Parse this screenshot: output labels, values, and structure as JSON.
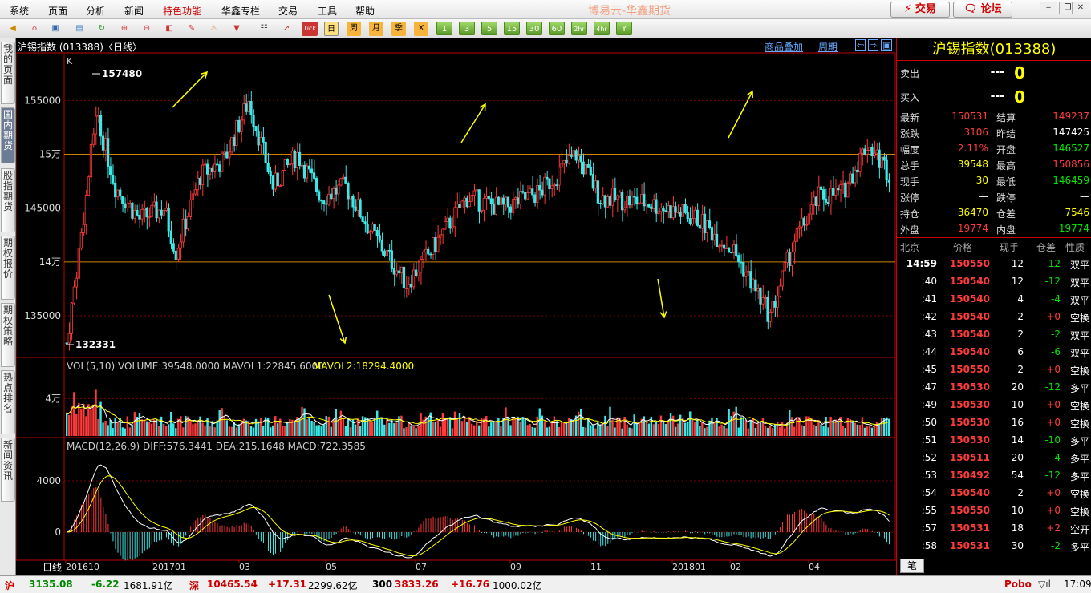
{
  "menu": [
    "系统",
    "页面",
    "分析",
    "新闻",
    "特色功能",
    "华鑫专栏",
    "交易",
    "工具",
    "帮助"
  ],
  "brand": "博易云-华鑫期货",
  "buttons": {
    "trade": "⚡ 交易",
    "forum": "🗨 论坛"
  },
  "toolbar": {
    "tick": "Tick",
    "day": "日",
    "week": "周",
    "month": "月",
    "season": "季",
    "x": "X",
    "nums": [
      "1",
      "3",
      "5",
      "15",
      "30",
      "60",
      "2hr",
      "4hr",
      "Y"
    ]
  },
  "sidebar": [
    "我的页面",
    "国内期货",
    "股指期货",
    "期权报价",
    "期权策略",
    "热点排名",
    "新闻资讯"
  ],
  "chart": {
    "title": "沪锡指数 (013388)〈日线〉",
    "links": [
      "商品叠加",
      "周期"
    ],
    "k_label": "K",
    "ymax_label": "157480",
    "ymin_label": "132331",
    "ytick": [
      "155000",
      "15万",
      "145000",
      "14万",
      "135000"
    ],
    "vol_title": "VOL(5,10)  VOLUME:39548.0000  MAVOL1:22845.6000",
    "vol_mavol2": "MAVOL2:18294.4000",
    "vol_tick": "4万",
    "macd_title": "MACD(12,26,9)  DIFF:576.3441  DEA:215.1648  MACD:722.3585",
    "macd_ticks": [
      "4000",
      "0"
    ],
    "period_label": "日线",
    "xlabels": [
      "201610",
      "201701",
      "03",
      "05",
      "07",
      "09",
      "11",
      "201801",
      "02",
      "04"
    ]
  },
  "chart_data": {
    "type": "candlestick",
    "title": "沪锡指数 (013388)〈日线〉",
    "yaxis_ticks": [
      135000,
      140000,
      145000,
      150000,
      155000
    ],
    "high": 157480,
    "low": 132331,
    "x_months": [
      "201610",
      "201701",
      "03",
      "05",
      "07",
      "09",
      "11",
      "201801",
      "02",
      "04"
    ],
    "volume": {
      "VOLUME": 39548,
      "MAVOL1": 22845.6,
      "MAVOL2": 18294.4
    },
    "macd": {
      "DIFF": 576.3441,
      "DEA": 215.1648,
      "MACD": 722.3585
    }
  },
  "panel": {
    "title": "沪锡指数(013388)",
    "sell": {
      "label": "卖出",
      "price": "---",
      "vol": "0"
    },
    "buy": {
      "label": "买入",
      "price": "---",
      "vol": "0"
    },
    "quote": [
      [
        "最新",
        "150531",
        "red",
        "结算",
        "149237",
        "red"
      ],
      [
        "涨跌",
        "3106",
        "red",
        "昨结",
        "147425",
        "white"
      ],
      [
        "幅度",
        "2.11%",
        "red",
        "开盘",
        "146527",
        "green"
      ],
      [
        "总手",
        "39548",
        "yellow",
        "最高",
        "150856",
        "red"
      ],
      [
        "现手",
        "30",
        "yellow",
        "最低",
        "146459",
        "green"
      ],
      [
        "涨停",
        "—",
        "white",
        "跌停",
        "—",
        "white"
      ],
      [
        "持仓",
        "36470",
        "yellow",
        "仓差",
        "7546",
        "yellow"
      ],
      [
        "外盘",
        "19774",
        "red",
        "内盘",
        "19774",
        "green"
      ]
    ],
    "tick_header": [
      "北京",
      "价格",
      "现手",
      "仓差",
      "性质"
    ],
    "ticks": [
      [
        "14:59",
        "150550",
        "12",
        "-12",
        "双平"
      ],
      [
        ":40",
        "150540",
        "12",
        "-12",
        "双平"
      ],
      [
        ":41",
        "150540",
        "4",
        "-4",
        "双平"
      ],
      [
        ":42",
        "150540",
        "2",
        "+0",
        "空换"
      ],
      [
        ":43",
        "150540",
        "2",
        "-2",
        "双平"
      ],
      [
        ":44",
        "150540",
        "6",
        "-6",
        "双平"
      ],
      [
        ":45",
        "150550",
        "2",
        "+0",
        "空换"
      ],
      [
        ":47",
        "150530",
        "20",
        "-12",
        "多平"
      ],
      [
        ":49",
        "150530",
        "10",
        "+0",
        "空换"
      ],
      [
        ":50",
        "150530",
        "16",
        "+0",
        "空换"
      ],
      [
        ":51",
        "150530",
        "14",
        "-10",
        "多平"
      ],
      [
        ":52",
        "150511",
        "20",
        "-4",
        "多平"
      ],
      [
        ":53",
        "150492",
        "54",
        "-12",
        "多平"
      ],
      [
        ":54",
        "150540",
        "2",
        "+0",
        "空换"
      ],
      [
        ":55",
        "150550",
        "10",
        "+0",
        "空换"
      ],
      [
        ":57",
        "150531",
        "18",
        "+2",
        "空开"
      ],
      [
        ":58",
        "150531",
        "30",
        "-2",
        "多平"
      ]
    ],
    "bottom_tab": "笔"
  },
  "status": {
    "sh": "沪",
    "sh_val": "3135.08",
    "sh_chg": "-6.22",
    "sh_amt": "1681.91亿",
    "sz": "深",
    "sz_val": "10465.54",
    "sz_chg": "+17.31",
    "sz_amt": "2299.62亿",
    "i300": "300",
    "i300_val": "3833.26",
    "i300_chg": "+16.76",
    "i300_amt": "1000.02亿",
    "pobo": "Pobo",
    "time": "17:09"
  }
}
